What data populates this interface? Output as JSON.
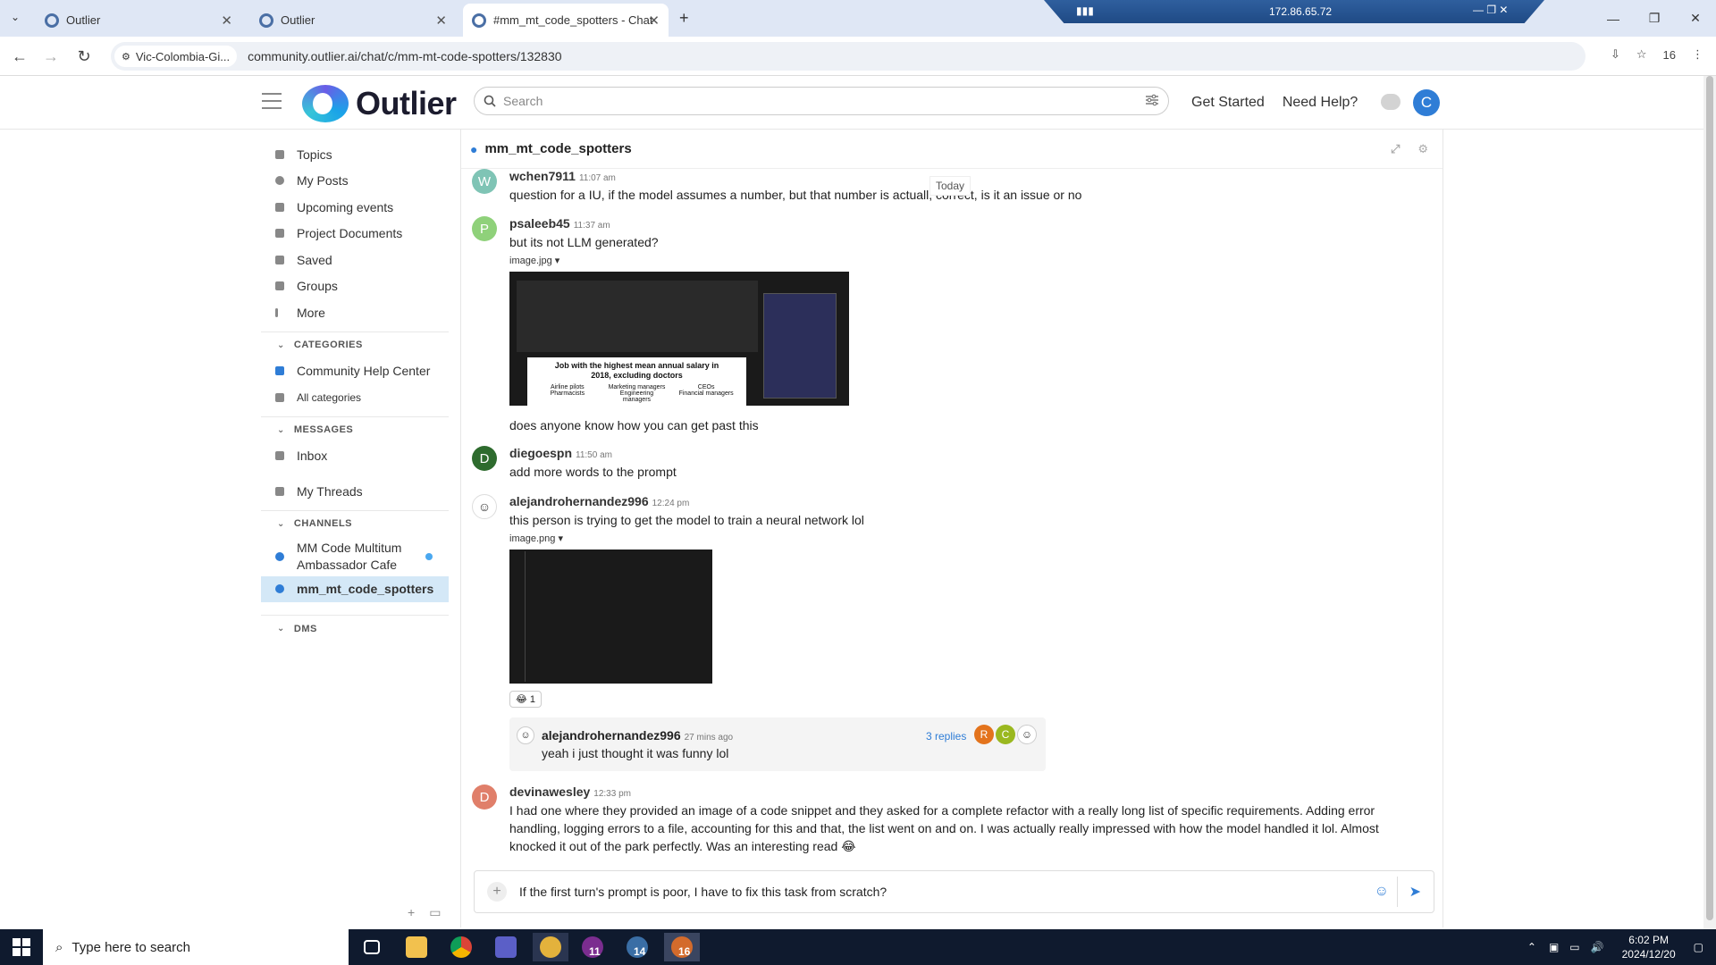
{
  "browser": {
    "tabs": [
      {
        "title": "Outlier",
        "active": false
      },
      {
        "title": "Outlier",
        "active": false
      },
      {
        "title": "#mm_mt_code_spotters - Chat",
        "active": true
      }
    ],
    "vpn_ip": "172.86.65.72",
    "site_info": "Vic-Colombia-Gi...",
    "url": "community.outlier.ai/chat/c/mm-mt-code-spotters/132830",
    "tab_count": "16"
  },
  "header": {
    "logo_text": "Outlier",
    "search_placeholder": "Search",
    "get_started": "Get Started",
    "need_help": "Need Help?",
    "avatar_initial": "C"
  },
  "sidebar": {
    "nav": [
      "Topics",
      "My Posts",
      "Upcoming events",
      "Project Documents",
      "Saved",
      "Groups",
      "More"
    ],
    "categories_title": "CATEGORIES",
    "categories": [
      "Community Help Center",
      "All categories"
    ],
    "messages_title": "MESSAGES",
    "messages": [
      "Inbox",
      "My Threads"
    ],
    "channels_title": "CHANNELS",
    "channels": [
      "MM Code Multitum Ambassador Cafe",
      "mm_mt_code_spotters"
    ],
    "dms_title": "DMS"
  },
  "chat": {
    "channel_name": "mm_mt_code_spotters",
    "today_label": "Today",
    "messages": [
      {
        "user": "wchen7911",
        "initial": "W",
        "time": "11:07 am",
        "text": "question for a IU, if the model assumes a number, but that number is actuall, correct, is it an issue or no"
      },
      {
        "user": "psaleeb45",
        "initial": "P",
        "time": "11:37 am",
        "text": "but its not LLM generated?",
        "attachment": "image.jpg",
        "after_text": "does anyone know how you can get past this"
      },
      {
        "user": "diegoespn",
        "initial": "D",
        "time": "11:50 am",
        "text": "add more words to the prompt"
      },
      {
        "user": "alejandrohernandez996",
        "time": "12:24 pm",
        "text": "this person is trying to get the model to train a neural network lol",
        "attachment": "image.png",
        "reaction_count": "1"
      },
      {
        "user": "devinawesley",
        "initial": "D",
        "time": "12:33 pm",
        "text": "I had one where they provided an image of a code snippet and they asked for a complete refactor with a really long list of specific requirements. Adding error handling, logging errors to a file, accounting for this and that, the list went on and on. I was actually really impressed with how the model handled it lol. Almost knocked it out of the park perfectly. Was an interesting read"
      }
    ],
    "thread": {
      "user": "alejandrohernandez996",
      "time": "27 mins ago",
      "text": "yeah i just thought it was funny lol",
      "replies": "3 replies",
      "reply_avatars": [
        "R",
        "C"
      ]
    },
    "embedded_image": {
      "chart_title": "Job with the highest mean annual salary in 2018, excluding doctors",
      "legend": [
        "Airline pilots",
        "Marketing managers",
        "CEOs",
        "Pharmacists",
        "Engineering managers",
        "Financial managers"
      ]
    },
    "composer_text": "If the first turn's prompt is poor, I have to fix this task from scratch?"
  },
  "taskbar": {
    "search_placeholder": "Type here to search",
    "badges": [
      "11",
      "14",
      "16"
    ],
    "time": "6:02 PM",
    "date": "2024/12/20"
  },
  "colors": {
    "accent": "#2f7dd6",
    "avatar_w": "#7fc4b5",
    "avatar_p": "#8fd17a",
    "avatar_d_green": "#2e6b2e",
    "avatar_d_red": "#e07f6a"
  }
}
